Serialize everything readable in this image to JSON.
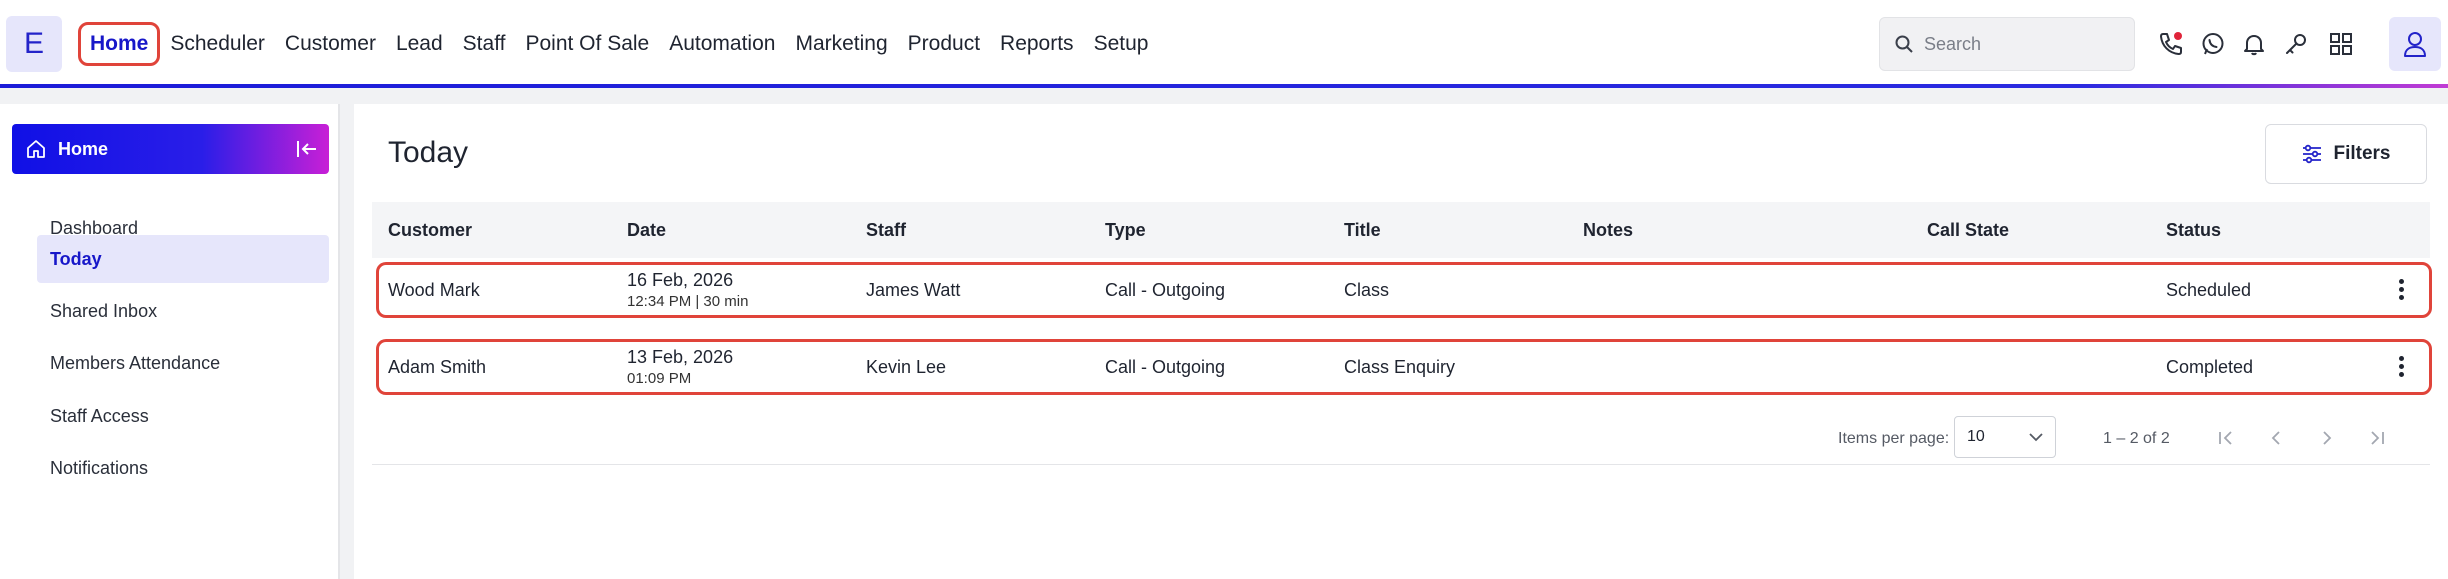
{
  "app": {
    "logo_letter": "E"
  },
  "nav": {
    "items": [
      {
        "label": "Home",
        "active": true
      },
      {
        "label": "Scheduler"
      },
      {
        "label": "Customer"
      },
      {
        "label": "Lead"
      },
      {
        "label": "Staff"
      },
      {
        "label": "Point Of Sale"
      },
      {
        "label": "Automation"
      },
      {
        "label": "Marketing"
      },
      {
        "label": "Product"
      },
      {
        "label": "Reports"
      },
      {
        "label": "Setup"
      }
    ]
  },
  "search": {
    "placeholder": "Search"
  },
  "top_icons": [
    "phone-icon",
    "whatsapp-icon",
    "bell-icon",
    "key-icon",
    "apps-grid-icon",
    "user-icon"
  ],
  "colors": {
    "accent": "#1717c9",
    "highlight": "#e0443a",
    "missed_dot": "#e0243a"
  },
  "sidebar": {
    "header": "Home",
    "items": [
      {
        "label": "Dashboard"
      },
      {
        "label": "Today",
        "active": true
      },
      {
        "label": "Shared Inbox"
      },
      {
        "label": "Members Attendance"
      },
      {
        "label": "Staff Access"
      },
      {
        "label": "Notifications"
      }
    ]
  },
  "main": {
    "title": "Today",
    "filters_label": "Filters",
    "columns": [
      "Customer",
      "Date",
      "Staff",
      "Type",
      "Title",
      "Notes",
      "Call State",
      "Status"
    ],
    "rows": [
      {
        "customer": "Wood Mark",
        "date": "16 Feb, 2026",
        "time": "12:34 PM | 30 min",
        "staff": "James Watt",
        "type": "Call - Outgoing",
        "title": "Class",
        "notes": "",
        "call_state": "",
        "status": "Scheduled"
      },
      {
        "customer": "Adam Smith",
        "date": "13 Feb, 2026",
        "time": "01:09 PM",
        "staff": "Kevin Lee",
        "type": "Call - Outgoing",
        "title": "Class Enquiry",
        "notes": "",
        "call_state": "",
        "status": "Completed"
      }
    ],
    "pager": {
      "items_label": "Items per page:",
      "page_size": "10",
      "range": "1 – 2 of 2"
    }
  }
}
